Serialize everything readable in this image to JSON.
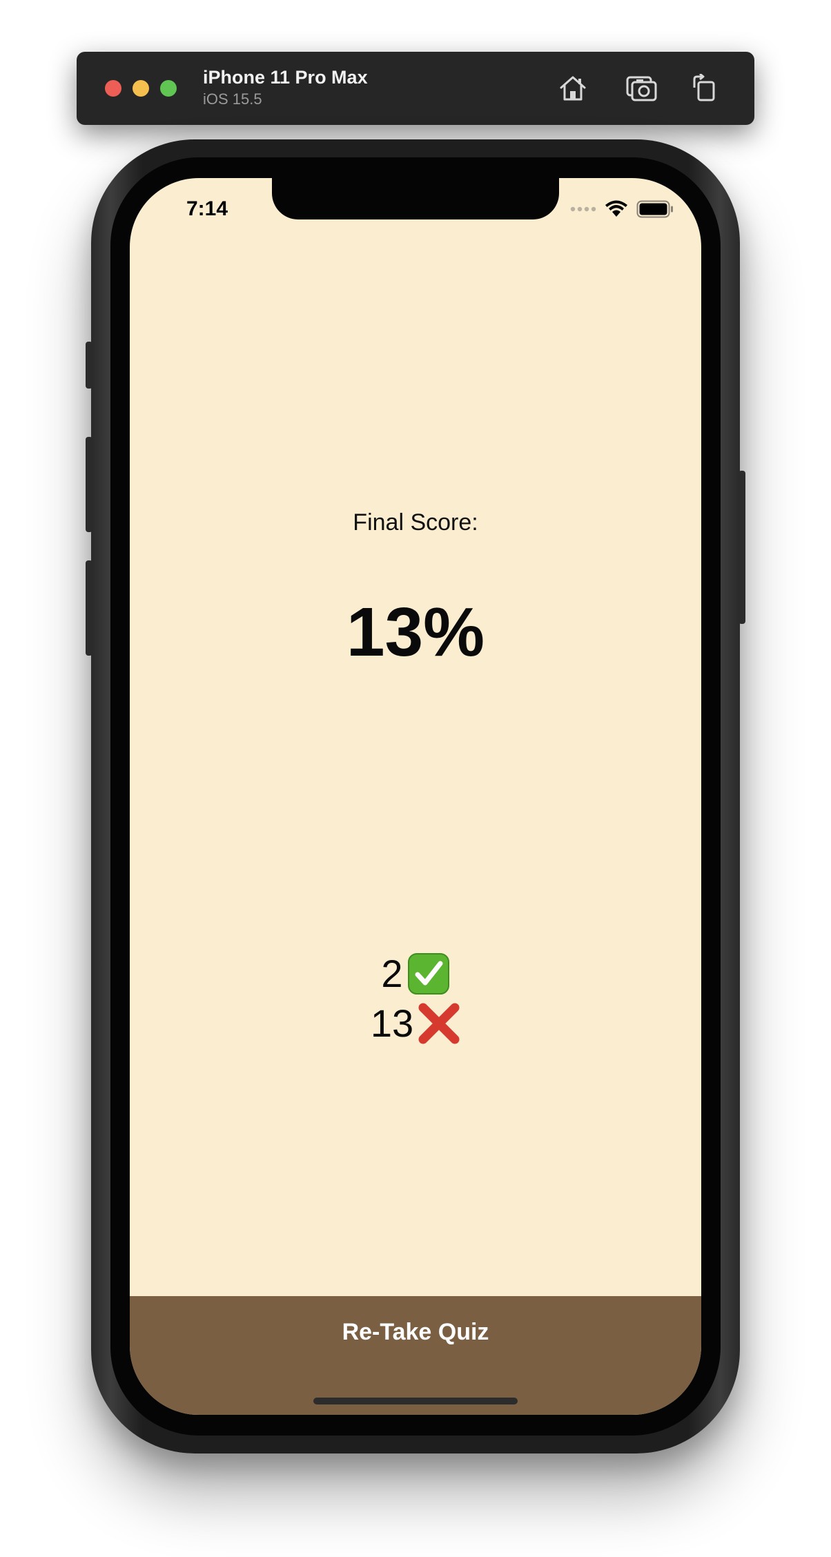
{
  "simulator": {
    "device_name": "iPhone 11 Pro Max",
    "os_version": "iOS 15.5",
    "buttons": {
      "home": "home-icon",
      "screenshot": "camera-icon",
      "rotate": "rotate-icon"
    },
    "traffic_light_colors": [
      "#ed5f56",
      "#f4bf4f",
      "#61c554"
    ]
  },
  "status_bar": {
    "time": "7:14",
    "icons": [
      "cellular-signal-icon",
      "wifi-icon",
      "battery-icon"
    ]
  },
  "results": {
    "label": "Final Score:",
    "score": "13%",
    "correct_count": "2",
    "correct_icon": "check-mark-icon",
    "wrong_count": "13",
    "wrong_icon": "cross-mark-icon"
  },
  "footer": {
    "retake_label": "Re-Take Quiz"
  },
  "colors": {
    "background": "#faedd0",
    "footer": "#7b5f42",
    "correct": "#5cb531",
    "wrong": "#d63a2f"
  }
}
